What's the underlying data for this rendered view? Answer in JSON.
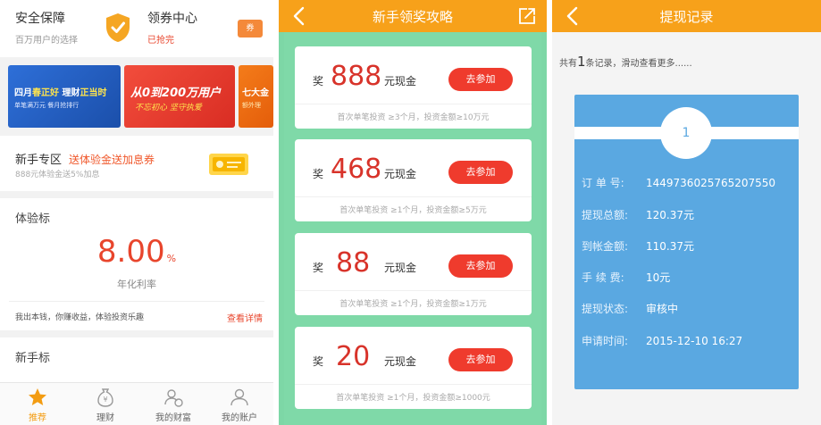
{
  "screen1": {
    "safety": {
      "title": "安全保障",
      "sub": "百万用户的选择"
    },
    "coupon_center": {
      "title": "领券中心",
      "sub": "已抢完",
      "icon_text": "券"
    },
    "banners": [
      {
        "title_a": "四月",
        "title_hl": "春正好",
        "title_b": " 理财",
        "title_hl2": "正当时",
        "sub": "单笔满万元  餐月抢排行"
      },
      {
        "title": "从0到200万用户",
        "sub": "不忘初心  坚守执爱"
      },
      {
        "title": "七大金",
        "sub": "额外理"
      }
    ],
    "newbie_zone": {
      "title": "新手专区",
      "highlight": "送体验金送加息券",
      "sub": "888元体验金送5%加息"
    },
    "experience": {
      "title": "体验标",
      "rate": "8.00",
      "rate_unit": "%",
      "rate_label": "年化利率",
      "footer": "我出本钱，你赚收益，体验投资乐趣",
      "more": "查看详情"
    },
    "newbie_product": {
      "title": "新手标"
    },
    "tabs": [
      {
        "label": "推荐",
        "active": true
      },
      {
        "label": "理财",
        "active": false
      },
      {
        "label": "我的财富",
        "active": false
      },
      {
        "label": "我的账户",
        "active": false
      }
    ]
  },
  "screen2": {
    "title": "新手领奖攻略",
    "rewards": [
      {
        "prefix": "奖",
        "amount": "888",
        "unit": "元现金",
        "button": "去参加",
        "condition": "首次单笔投资 ≥3个月，投资金额≥10万元"
      },
      {
        "prefix": "奖",
        "amount": "468",
        "unit": "元现金",
        "button": "去参加",
        "condition": "首次单笔投资 ≥1个月，投资金额≥5万元"
      },
      {
        "prefix": "奖",
        "amount": "88",
        "unit": "元现金",
        "button": "去参加",
        "condition": "首次单笔投资 ≥1个月，投资金额≥1万元"
      },
      {
        "prefix": "奖",
        "amount": "20",
        "unit": "元现金",
        "button": "去参加",
        "condition": "首次单笔投资 ≥1个月，投资金额≥1000元"
      }
    ]
  },
  "screen3": {
    "title": "提现记录",
    "note_a": "共有",
    "note_count": "1",
    "note_b": "条记录，滑动查看更多......",
    "record": {
      "index": "1",
      "rows": [
        {
          "key": "订 单 号:",
          "value": "1449736025765207550"
        },
        {
          "key": "提现总额:",
          "value": "120.37元"
        },
        {
          "key": "到帐金额:",
          "value": "110.37元"
        },
        {
          "key": "手 续 费:",
          "value": "10元"
        },
        {
          "key": "提现状态:",
          "value": "审核中"
        },
        {
          "key": "申请时间:",
          "value": "2015-12-10 16:27"
        }
      ]
    }
  },
  "colors": {
    "header_orange": "#f7a11a",
    "reward_red": "#d8332a",
    "button_red": "#ef3b2d",
    "green_bg": "#7dd7a6",
    "record_blue": "#5aa8e1"
  }
}
